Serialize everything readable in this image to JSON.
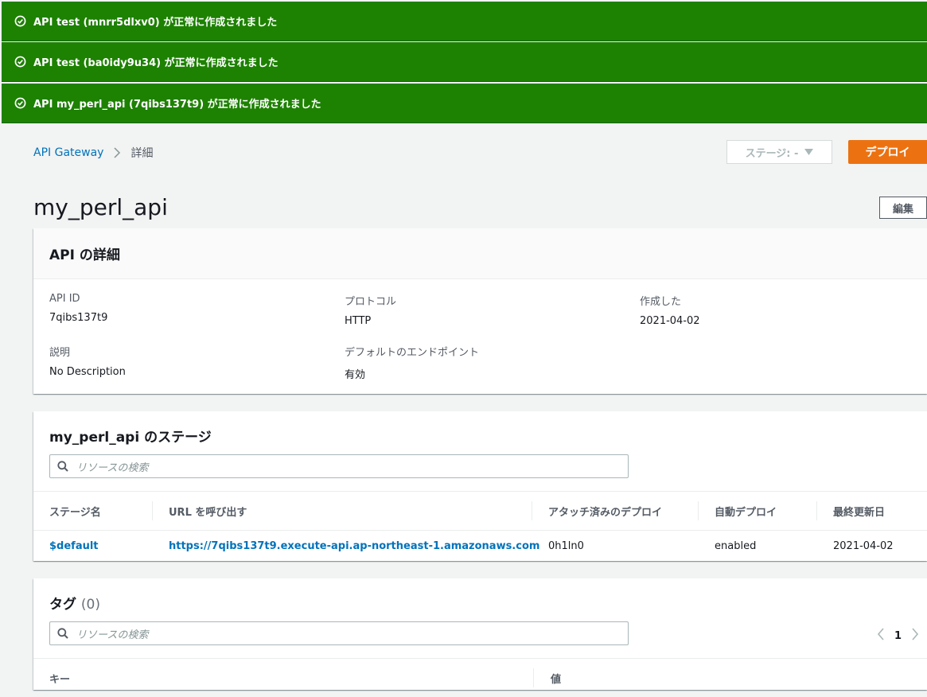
{
  "flash": [
    {
      "icon": "check-circle-icon",
      "message": "API test (mnrr5dlxv0) が正常に作成されました"
    },
    {
      "icon": "check-circle-icon",
      "message": "API test (ba0idy9u34) が正常に作成されました"
    },
    {
      "icon": "check-circle-icon",
      "message": "API my_perl_api (7qibs137t9) が正常に作成されました"
    }
  ],
  "breadcrumb": {
    "root": "API Gateway",
    "current": "詳細"
  },
  "toolbar": {
    "stage_select": "ステージ: -",
    "deploy_label": "デプロイ",
    "edit_label": "編集"
  },
  "page": {
    "title": "my_perl_api"
  },
  "details": {
    "title": "API の詳細",
    "fields": [
      {
        "label": "API ID",
        "value": "7qibs137t9"
      },
      {
        "label": "プロトコル",
        "value": "HTTP"
      },
      {
        "label": "作成した",
        "value": "2021-04-02"
      },
      {
        "label": "説明",
        "value": "No Description"
      },
      {
        "label": "デフォルトのエンドポイント",
        "value": "有効"
      }
    ]
  },
  "stages": {
    "title": "my_perl_api のステージ",
    "search_placeholder": "リソースの検索",
    "columns": [
      "ステージ名",
      "URL を呼び出す",
      "アタッチ済みのデプロイ",
      "自動デプロイ",
      "最終更新日"
    ],
    "rows": [
      [
        "$default",
        "https://7qibs137t9.execute-api.ap-northeast-1.amazonaws.com",
        "0h1ln0",
        "enabled",
        "2021-04-02"
      ]
    ]
  },
  "tags": {
    "title": "タグ",
    "count": "(0)",
    "search_placeholder": "リソースの検索",
    "page": "1",
    "columns": [
      "キー",
      "値"
    ]
  },
  "colors": {
    "success": "#1d8102",
    "accent": "#ec7211",
    "link": "#0073bb"
  }
}
